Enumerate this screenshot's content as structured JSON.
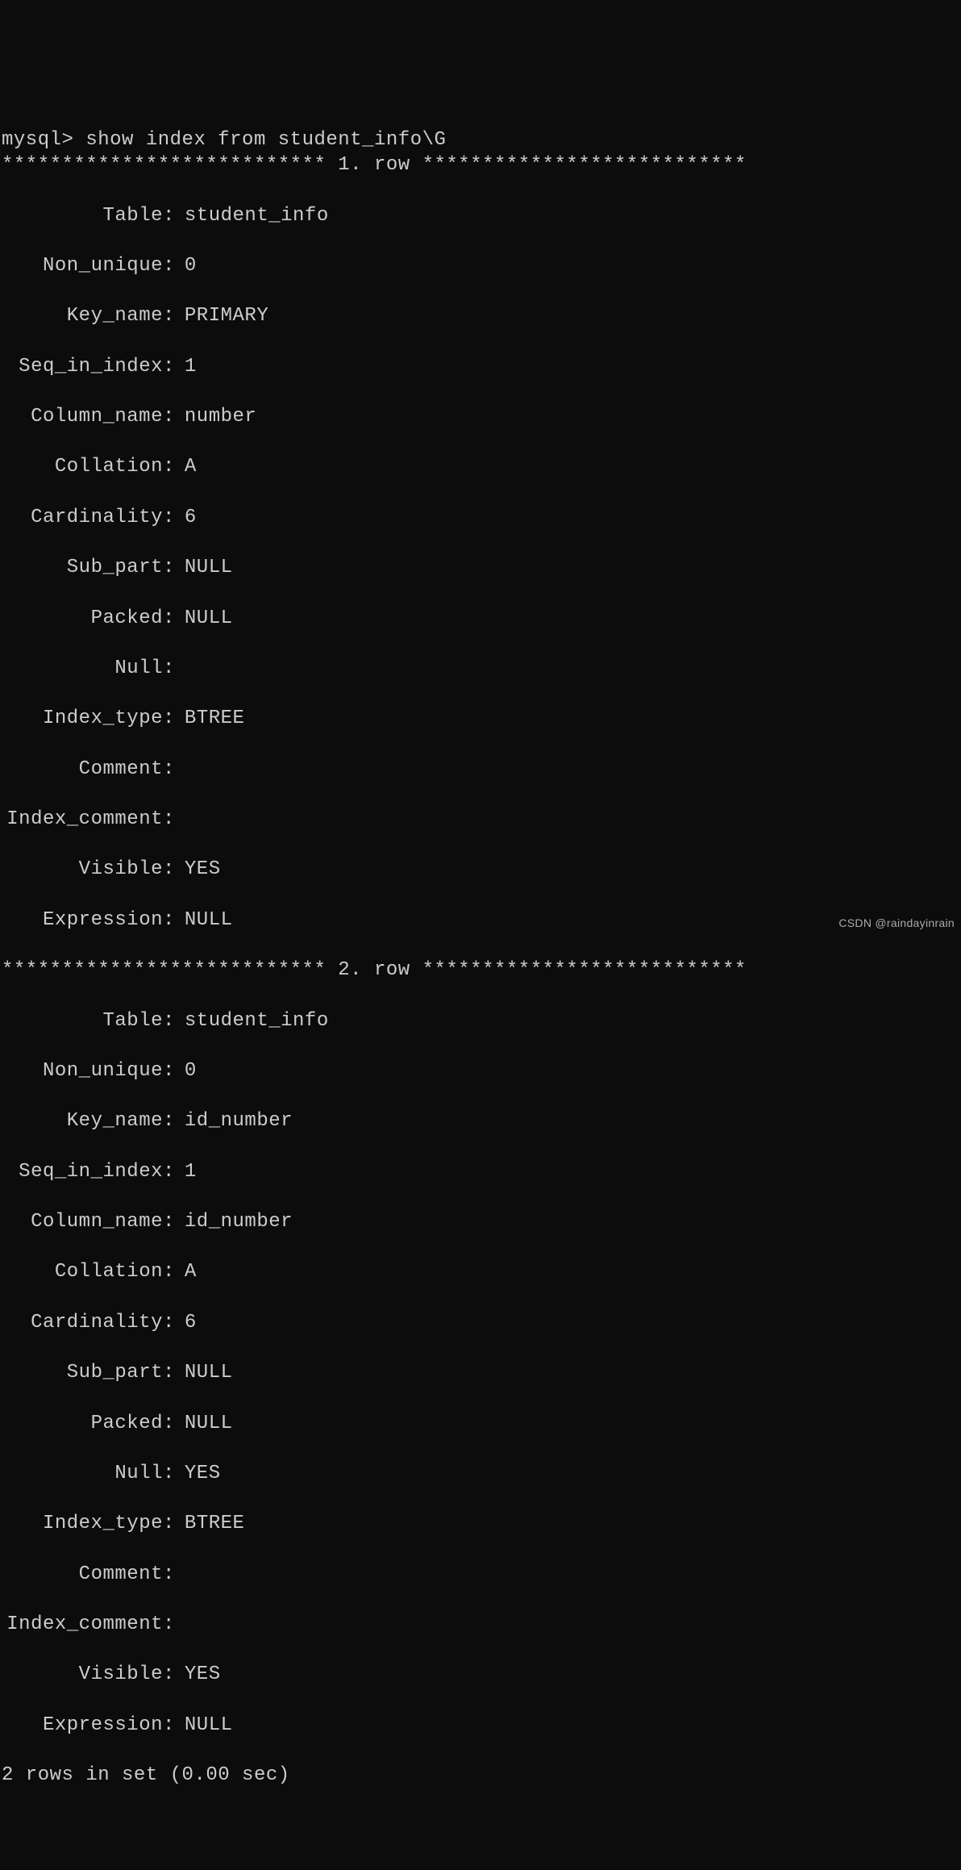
{
  "prompt": "mysql> ",
  "command": "show index from student_info\\G",
  "row_separator_1": "*************************** 1. row ***************************",
  "row_separator_2": "*************************** 2. row ***************************",
  "rows": [
    {
      "Table": "student_info",
      "Non_unique": "0",
      "Key_name": "PRIMARY",
      "Seq_in_index": "1",
      "Column_name": "number",
      "Collation": "A",
      "Cardinality": "6",
      "Sub_part": "NULL",
      "Packed": "NULL",
      "Null": "",
      "Index_type": "BTREE",
      "Comment": "",
      "Index_comment": "",
      "Visible": "YES",
      "Expression": "NULL"
    },
    {
      "Table": "student_info",
      "Non_unique": "0",
      "Key_name": "id_number",
      "Seq_in_index": "1",
      "Column_name": "id_number",
      "Collation": "A",
      "Cardinality": "6",
      "Sub_part": "NULL",
      "Packed": "NULL",
      "Null": "YES",
      "Index_type": "BTREE",
      "Comment": "",
      "Index_comment": "",
      "Visible": "YES",
      "Expression": "NULL"
    }
  ],
  "labels": {
    "Table": "Table",
    "Non_unique": "Non_unique",
    "Key_name": "Key_name",
    "Seq_in_index": "Seq_in_index",
    "Column_name": "Column_name",
    "Collation": "Collation",
    "Cardinality": "Cardinality",
    "Sub_part": "Sub_part",
    "Packed": "Packed",
    "Null": "Null",
    "Index_type": "Index_type",
    "Comment": "Comment",
    "Index_comment": "Index_comment",
    "Visible": "Visible",
    "Expression": "Expression"
  },
  "footer": "2 rows in set (0.00 sec)",
  "watermark": "CSDN @raindayinrain"
}
